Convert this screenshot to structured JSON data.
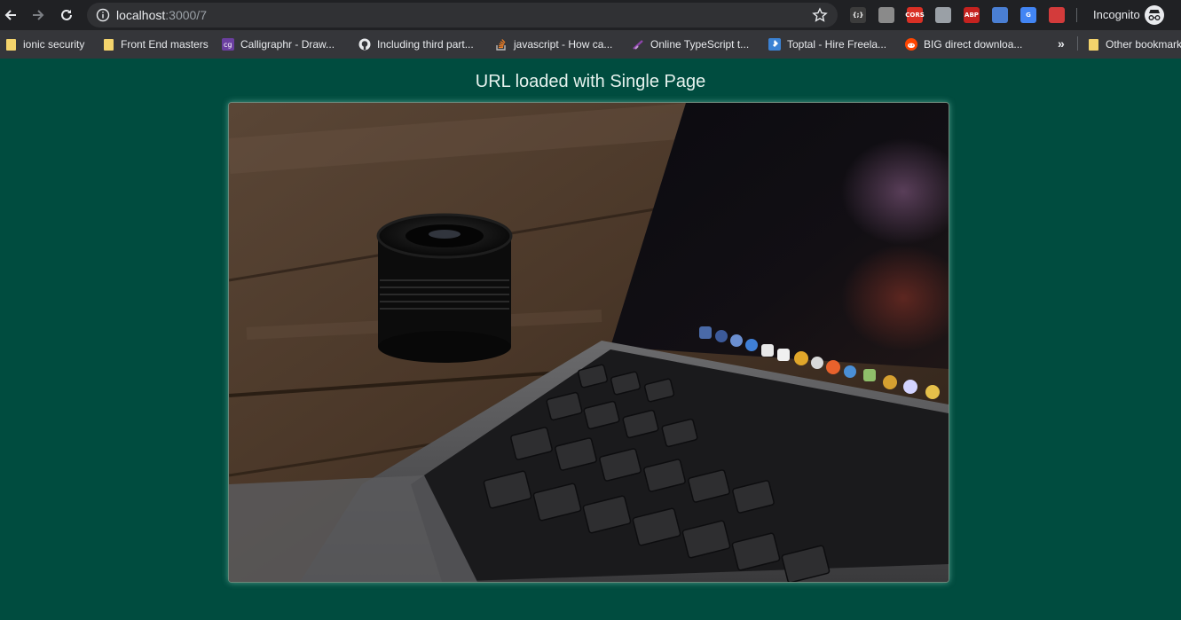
{
  "browser": {
    "url_host": "localhost",
    "url_path": ":3000/7",
    "incognito_label": "Incognito",
    "extensions": [
      {
        "name": "json-ext-icon",
        "text": "{;}",
        "color": "#3c3c3c"
      },
      {
        "name": "grey-ext-icon",
        "text": "",
        "color": "#8a8a8a"
      },
      {
        "name": "cors-ext-icon",
        "text": "CORS",
        "color": "#d93025"
      },
      {
        "name": "shield-ext-icon",
        "text": "",
        "color": "#9aa0a6"
      },
      {
        "name": "adblock-ext-icon",
        "text": "ABP",
        "color": "#c5221f"
      },
      {
        "name": "chat-ext-icon",
        "text": "",
        "color": "#4a7fd4"
      },
      {
        "name": "google-translate-icon",
        "text": "G",
        "color": "#4285f4"
      },
      {
        "name": "red-ext-icon",
        "text": "",
        "color": "#d33b3b"
      }
    ]
  },
  "bookmarks": {
    "items": [
      {
        "label": "ionic security",
        "icon": "folder-icon"
      },
      {
        "label": "Front End masters",
        "icon": "folder-icon"
      },
      {
        "label": "Calligraphr - Draw...",
        "icon": "calligraphr-icon"
      },
      {
        "label": "Including third part...",
        "icon": "github-icon"
      },
      {
        "label": "javascript - How ca...",
        "icon": "stackoverflow-icon"
      },
      {
        "label": "Online TypeScript t...",
        "icon": "typescript-icon"
      },
      {
        "label": "Toptal - Hire Freela...",
        "icon": "toptal-icon"
      },
      {
        "label": "BIG direct downloa...",
        "icon": "reddit-icon"
      }
    ],
    "more": "»",
    "other": "Other bookmarks"
  },
  "page": {
    "title": "URL loaded with Single Page"
  },
  "colors": {
    "page_background": "#004c3f",
    "chrome_dark": "#202124",
    "bookmarks_bar": "#35363a"
  }
}
